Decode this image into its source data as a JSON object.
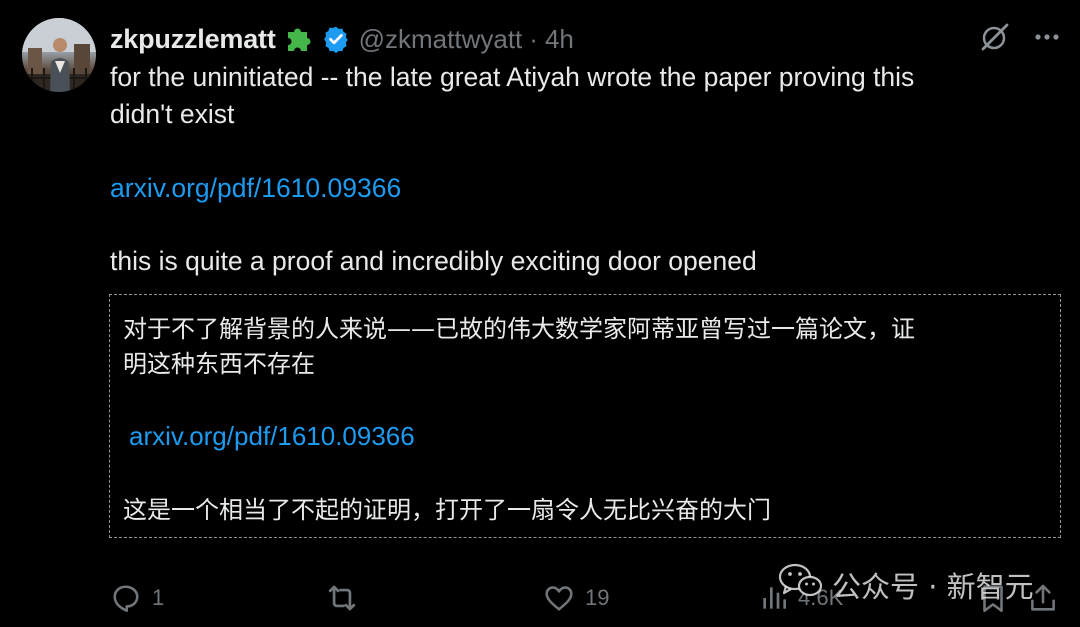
{
  "tweet": {
    "author": {
      "display_name": "zkpuzzlematt",
      "handle": "@zkmattwyatt",
      "separator": "·",
      "time": "4h",
      "badge_icon": "puzzle-piece-icon",
      "verified_icon": "verified-badge-icon"
    },
    "text_lines": [
      "for the uninitiated -- the late great Atiyah wrote the paper proving this",
      "didn't exist"
    ],
    "link": "arxiv.org/pdf/1610.09366",
    "closing_line": "this is quite a proof and incredibly exciting door opened",
    "translation": {
      "lines": [
        "对于不了解背景的人来说——已故的伟大数学家阿蒂亚曾写过一篇论文，证",
        "明这种东西不存在"
      ],
      "link": "arxiv.org/pdf/1610.09366",
      "closing_line": "这是一个相当了不起的证明，打开了一扇令人无比兴奋的大门"
    },
    "actions": {
      "reply_count": "1",
      "repost_count": "",
      "like_count": "19",
      "views_count": "4.6K"
    },
    "colors": {
      "background": "#000000",
      "text": "#e7e9ea",
      "secondary": "#71767b",
      "link": "#1d9bf0",
      "verified": "#1d9bf0",
      "badge": "#45b649"
    }
  },
  "watermark": {
    "text": "公众号 · 新智元",
    "icon": "wechat-icon"
  }
}
